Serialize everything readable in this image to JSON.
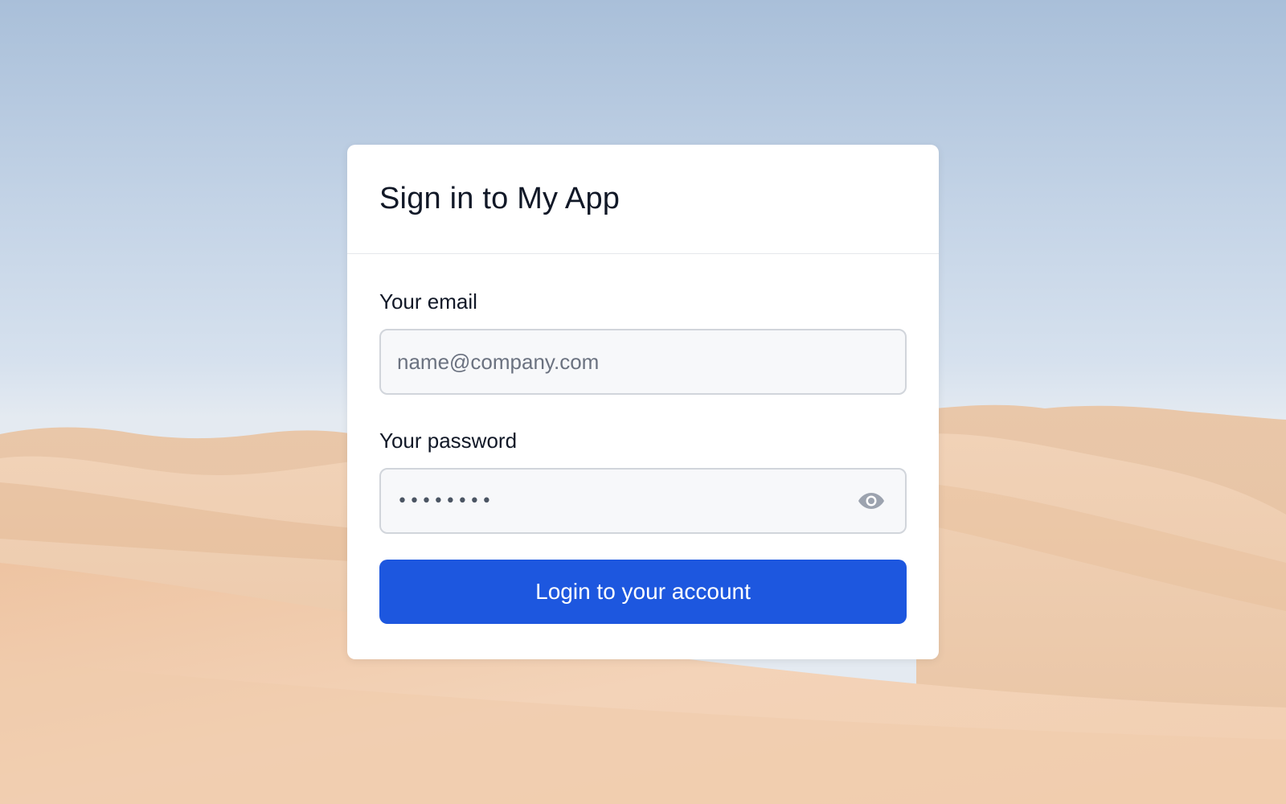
{
  "page": {
    "title": "Sign in to My App"
  },
  "form": {
    "email_label": "Your email",
    "email_placeholder": "name@company.com",
    "email_value": "",
    "password_label": "Your password",
    "password_value": "••••••••",
    "password_toggle_icon": "eye-icon",
    "submit_label": "Login to your account"
  },
  "colors": {
    "primary_button": "#1d57df",
    "card_background": "#ffffff",
    "input_background": "#f7f8fa",
    "input_border": "#d1d5db",
    "heading_text": "#111827",
    "placeholder_text": "#6b7280",
    "icon_gray": "#9ca3af"
  },
  "background": {
    "description_icon": "desert-dunes-background"
  }
}
